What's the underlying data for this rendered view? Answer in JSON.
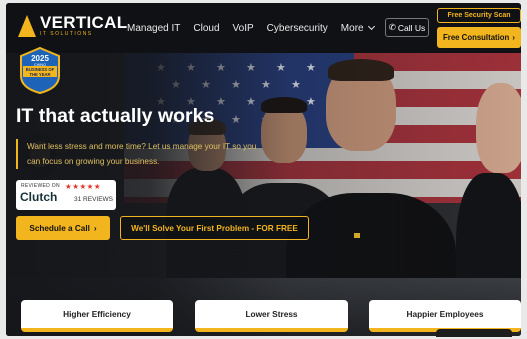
{
  "header": {
    "brand_name": "VERTICAL",
    "brand_sub": "IT SOLUTIONS",
    "nav": [
      "Managed IT",
      "Cloud",
      "VoIP",
      "Cybersecurity",
      "More"
    ],
    "call_label": "Call Us",
    "scan_label": "Free Security Scan",
    "consult_label": "Free Consultation"
  },
  "badge": {
    "year": "2025",
    "line1": "CHINO",
    "line2": "BUSINESS OF",
    "line3": "THE YEAR"
  },
  "hero": {
    "headline": "IT that actually works",
    "subtext": "Want less stress and more time? Let us manage your IT so you can focus on growing your business.",
    "clutch": {
      "reviewed_on": "REVIEWED ON",
      "name": "Clutch",
      "stars": "★★★★★",
      "reviews": "31 REVIEWS"
    },
    "schedule_label": "Schedule a Call",
    "solve_label": "We'll Solve Your First Problem - FOR FREE"
  },
  "cards": [
    "Higher Efficiency",
    "Lower Stress",
    "Happier Employees"
  ],
  "colors": {
    "accent": "#f2b51d",
    "dark": "#101114",
    "clutch_star": "#e13a2f"
  }
}
